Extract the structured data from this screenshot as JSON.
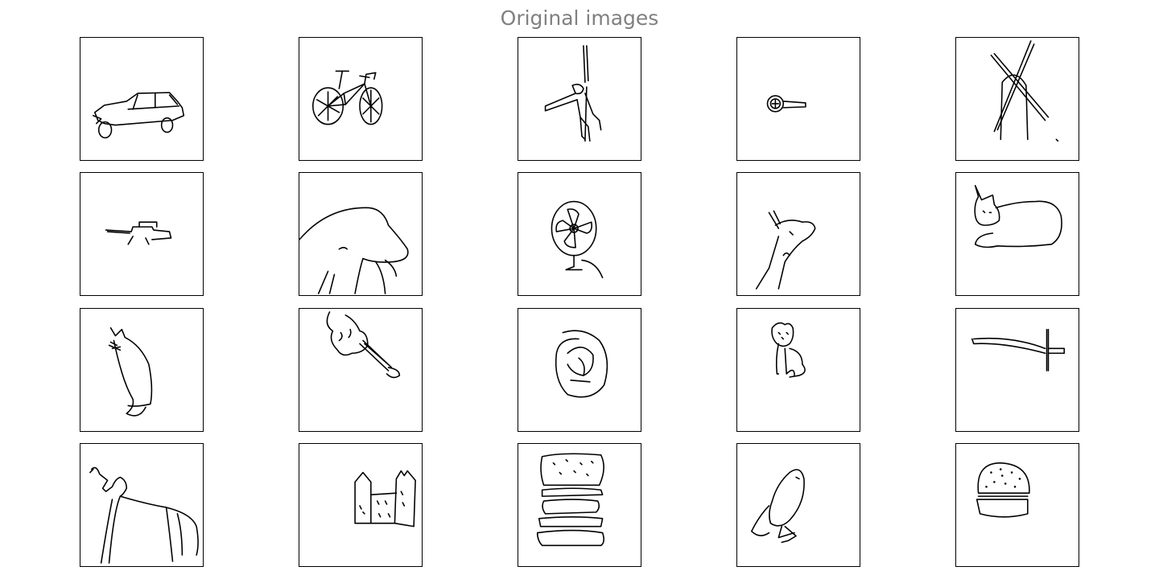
{
  "figure": {
    "title": "Original images",
    "colors": {
      "title": "#808080",
      "frame": "#000000",
      "stroke": "#000000",
      "background": "#ffffff"
    }
  },
  "panels": [
    {
      "icon": "car-sketch-icon"
    },
    {
      "icon": "bicycle-sketch-icon"
    },
    {
      "icon": "monkey-sketch-icon"
    },
    {
      "icon": "key-sketch-icon"
    },
    {
      "icon": "windmill-sketch-icon"
    },
    {
      "icon": "rifle-sketch-icon"
    },
    {
      "icon": "dolphin-sketch-icon"
    },
    {
      "icon": "fan-sketch-icon"
    },
    {
      "icon": "giraffe-sketch-icon"
    },
    {
      "icon": "cat-sketch-icon"
    },
    {
      "icon": "cat-standing-sketch-icon"
    },
    {
      "icon": "violin-sketch-icon"
    },
    {
      "icon": "pretzel-sketch-icon"
    },
    {
      "icon": "teddy-bear-sketch-icon"
    },
    {
      "icon": "sword-sketch-icon"
    },
    {
      "icon": "dog-sketch-icon"
    },
    {
      "icon": "castle-sketch-icon"
    },
    {
      "icon": "hamburger-sketch-icon"
    },
    {
      "icon": "bird-sketch-icon"
    },
    {
      "icon": "burger-sketch-icon"
    }
  ]
}
